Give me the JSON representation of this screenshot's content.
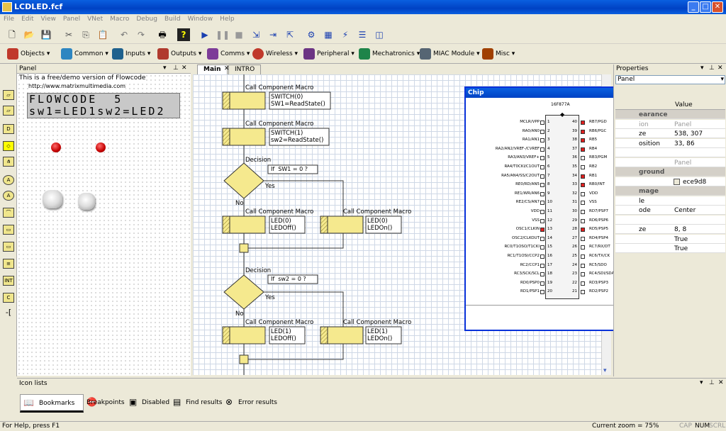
{
  "window": {
    "title": "LCDLED.fcf"
  },
  "menu": [
    "File",
    "Edit",
    "View",
    "Panel",
    "VNet",
    "Macro",
    "Debug",
    "Build",
    "Window",
    "Help"
  ],
  "toolbar2": [
    {
      "label": "Objects",
      "icon": "objects-icon",
      "color": "#c0392b"
    },
    {
      "label": "Common",
      "icon": "common-icon",
      "color": "#2e86c1"
    },
    {
      "label": "Inputs",
      "icon": "inputs-icon",
      "color": "#1f618d"
    },
    {
      "label": "Outputs",
      "icon": "outputs-icon",
      "color": "#b03a2e"
    },
    {
      "label": "Comms",
      "icon": "comms-icon",
      "color": "#7d3c98"
    },
    {
      "label": "Wireless",
      "icon": "wireless-icon",
      "color": "#c0392b"
    },
    {
      "label": "Peripheral",
      "icon": "peripheral-icon",
      "color": "#6c3483"
    },
    {
      "label": "Mechatronics",
      "icon": "mechatronics-icon",
      "color": "#1e8449"
    },
    {
      "label": "MIAC Module",
      "icon": "miac-icon",
      "color": "#566573"
    },
    {
      "label": "Misc",
      "icon": "misc-icon",
      "color": "#a04000"
    }
  ],
  "panel": {
    "header": "Panel",
    "demo_line1": "This is a free/demo version of Flowcode",
    "demo_line2": "http://www.matrixmultimedia.com",
    "lcd_line1": "FLOWCODE  5",
    "lcd_line2": "sw1=LED1sw2=LED2"
  },
  "tabs": [
    "Main",
    "INTRO"
  ],
  "flow": {
    "m1_title": "Call Component Macro",
    "m1_l1": "SWITCH(0)",
    "m1_l2": "SW1=ReadState()",
    "m2_title": "Call Component Macro",
    "m2_l1": "SWITCH(1)",
    "m2_l2": "sw2=ReadState()",
    "d1_title": "Decision",
    "d1_cond": "If  SW1 = 0 ?",
    "d1_yes": "Yes",
    "d1_no": "No",
    "m3_title": "Call Component Macro",
    "m3_l1": "LED(0)",
    "m3_l2": "LEDOff()",
    "m4_title": "Call Component Macro",
    "m4_l1": "LED(0)",
    "m4_l2": "LEDOn()",
    "d2_title": "Decision",
    "d2_cond": "If  sw2 = 0 ?",
    "d2_yes": "Yes",
    "d2_no": "No",
    "m5_title": "Call Component Macro",
    "m5_l1": "LED(1)",
    "m5_l2": "LEDOff()",
    "m6_title": "Call Component Macro",
    "m6_l1": "LED(1)",
    "m6_l2": "LEDOn()"
  },
  "chip": {
    "title": "Chip",
    "part": "16F877A",
    "left_pins": [
      "MCLR/VPP",
      "RA0/AN0",
      "RA1/AN1",
      "RA2/AN2/VREF-/CVREF",
      "RA3/AN3/VREF+",
      "RA4/T0CKI/C1OUT",
      "RA5/AN4/SS/C2OUT",
      "RE0/RD/AN5",
      "RE1/WR/AN6",
      "RE2/CS/AN7",
      "VDD",
      "VSS",
      "OSC1/CLKIN",
      "OSC2/CLKOUT",
      "RC0/T1OSO/T1CKI",
      "RC1/T1OSI/CCP2",
      "RC2/CCP1",
      "RC3/SCK/SCL",
      "RD0/PSP0",
      "RD1/PSP1"
    ],
    "right_pins": [
      "RB7/PGD",
      "RB6/PGC",
      "RB5",
      "RB4",
      "RB3/PGM",
      "RB2",
      "RB1",
      "RB0/INT",
      "VDD",
      "VSS",
      "RD7/PSP7",
      "RD6/PSP6",
      "RD5/PSP5",
      "RD4/PSP4",
      "RC7/RX/DT",
      "RC6/TX/CK",
      "RC5/SDO",
      "RC4/SDI/SDA",
      "RD3/PSP3",
      "RD2/PSP2"
    ],
    "left_nums": [
      "1",
      "2",
      "3",
      "4",
      "5",
      "6",
      "7",
      "8",
      "9",
      "10",
      "11",
      "12",
      "13",
      "14",
      "15",
      "16",
      "17",
      "18",
      "19",
      "20"
    ],
    "right_nums": [
      "40",
      "39",
      "38",
      "37",
      "36",
      "35",
      "34",
      "33",
      "32",
      "31",
      "30",
      "29",
      "28",
      "27",
      "26",
      "25",
      "24",
      "23",
      "22",
      "21"
    ],
    "left_red": [
      false,
      false,
      false,
      false,
      false,
      false,
      false,
      false,
      false,
      false,
      false,
      false,
      true,
      false,
      false,
      false,
      false,
      false,
      false,
      false
    ],
    "right_red": [
      true,
      true,
      true,
      true,
      false,
      false,
      true,
      true,
      false,
      false,
      false,
      false,
      true,
      false,
      false,
      false,
      false,
      false,
      false,
      false
    ]
  },
  "properties": {
    "header": "Properties",
    "selector": "Panel",
    "col_value": "Value",
    "rows": [
      {
        "k": "earance",
        "v": "",
        "section": true
      },
      {
        "k": "ion",
        "v": "Panel",
        "grey": true
      },
      {
        "k": "ze",
        "v": "538, 307"
      },
      {
        "k": "osition",
        "v": "33, 86"
      },
      {
        "k": "",
        "v": ""
      },
      {
        "k": "",
        "v": "Panel",
        "grey": true
      },
      {
        "k": "ground",
        "v": "",
        "section": true
      },
      {
        "k": "",
        "v": "ece9d8",
        "swatch": true
      },
      {
        "k": "mage",
        "v": "",
        "section": true
      },
      {
        "k": "le",
        "v": ""
      },
      {
        "k": "ode",
        "v": "Center"
      },
      {
        "k": "",
        "v": ""
      },
      {
        "k": "ze",
        "v": "8, 8"
      },
      {
        "k": "",
        "v": "True"
      },
      {
        "k": "",
        "v": "True"
      }
    ]
  },
  "iconlists": {
    "header": "Icon lists",
    "tabs": [
      {
        "label": "Bookmarks",
        "icon": "bookmarks-icon"
      },
      {
        "label": "Breakpoints",
        "icon": "breakpoints-icon"
      },
      {
        "label": "Disabled",
        "icon": "disabled-icon"
      },
      {
        "label": "Find results",
        "icon": "find-results-icon"
      },
      {
        "label": "Error results",
        "icon": "error-results-icon"
      }
    ]
  },
  "status": {
    "help": "For Help, press F1",
    "zoom": "Current zoom = 75%",
    "cap": "CAP",
    "num": "NUM",
    "scrl": "SCRL"
  }
}
